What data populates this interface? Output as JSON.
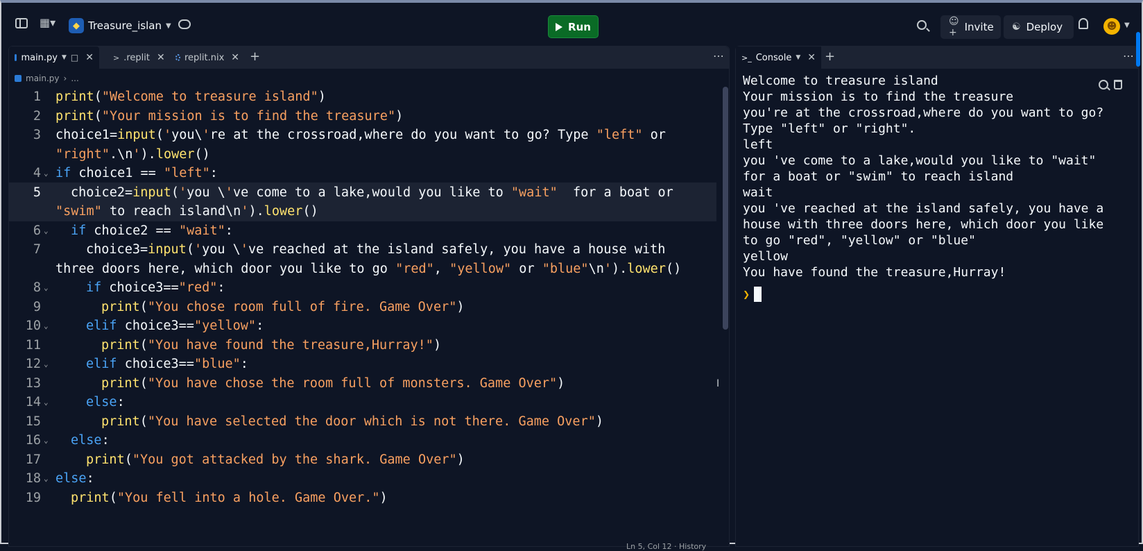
{
  "topbar": {
    "project_name": "Treasure_islan",
    "run_label": "Run",
    "invite_label": "Invite",
    "deploy_label": "Deploy"
  },
  "editor": {
    "tabs": [
      {
        "label": "main.py",
        "active": true
      },
      {
        "label": ".replit",
        "active": false
      },
      {
        "label": "replit.nix",
        "active": false
      }
    ],
    "breadcrumb": [
      "main.py",
      "..."
    ],
    "status": "Ln 5, Col 12 · History"
  },
  "code_lines": [
    {
      "num": "1",
      "fold": false,
      "indent": 0,
      "text": "print(\"Welcome to treasure island\")"
    },
    {
      "num": "2",
      "fold": false,
      "indent": 0,
      "text": "print(\"Your mission is to find the treasure\")"
    },
    {
      "num": "3",
      "fold": false,
      "indent": 0,
      "text": "choice1=input('you\\'re at the crossroad,where do you want to go? Type \"left\" or"
    },
    {
      "num": "",
      "fold": false,
      "indent": 0,
      "text": "\"right\".\\n').lower()"
    },
    {
      "num": "4",
      "fold": true,
      "indent": 0,
      "text": "if choice1 == \"left\":"
    },
    {
      "num": "5",
      "fold": false,
      "indent": 1,
      "text": "choice2=input('you \\'ve come to a lake,would you like to \"wait\"  for a boat or"
    },
    {
      "num": "",
      "fold": false,
      "indent": 0,
      "text": "\"swim\" to reach island\\n').lower()"
    },
    {
      "num": "6",
      "fold": true,
      "indent": 1,
      "text": "if choice2 == \"wait\":"
    },
    {
      "num": "7",
      "fold": false,
      "indent": 2,
      "text": "choice3=input('you \\'ve reached at the island safely, you have a house with"
    },
    {
      "num": "",
      "fold": false,
      "indent": 0,
      "text": "three doors here, which door you like to go \"red\", \"yellow\" or \"blue\"\\n').lower()"
    },
    {
      "num": "8",
      "fold": true,
      "indent": 2,
      "text": "if choice3==\"red\":"
    },
    {
      "num": "9",
      "fold": false,
      "indent": 3,
      "text": "print(\"You chose room full of fire. Game Over\")"
    },
    {
      "num": "10",
      "fold": true,
      "indent": 2,
      "text": "elif choice3==\"yellow\":"
    },
    {
      "num": "11",
      "fold": false,
      "indent": 3,
      "text": "print(\"You have found the treasure,Hurray!\")"
    },
    {
      "num": "12",
      "fold": true,
      "indent": 2,
      "text": "elif choice3==\"blue\":"
    },
    {
      "num": "13",
      "fold": false,
      "indent": 3,
      "text": "print(\"You have chose the room full of monsters. Game Over\")"
    },
    {
      "num": "14",
      "fold": true,
      "indent": 2,
      "text": "else:"
    },
    {
      "num": "15",
      "fold": false,
      "indent": 3,
      "text": "print(\"You have selected the door which is not there. Game Over\")"
    },
    {
      "num": "16",
      "fold": true,
      "indent": 1,
      "text": "else:"
    },
    {
      "num": "17",
      "fold": false,
      "indent": 2,
      "text": "print(\"You got attacked by the shark. Game Over\")"
    },
    {
      "num": "18",
      "fold": true,
      "indent": 0,
      "text": "else:"
    },
    {
      "num": "19",
      "fold": false,
      "indent": 1,
      "text": "print(\"You fell into a hole. Game Over.\")"
    }
  ],
  "console": {
    "tab_label": "Console",
    "output": [
      "Welcome to treasure island",
      "Your mission is to find the treasure",
      "you're at the crossroad,where do you want to go?",
      "Type \"left\" or \"right\".",
      "left",
      "you 've come to a lake,would you like to \"wait\"",
      "for a boat or \"swim\" to reach island",
      "wait",
      "you 've reached at the island safely, you have a",
      "house with three doors here, which door you like",
      "to go \"red\", \"yellow\" or \"blue\"",
      "yellow",
      "You have found the treasure,Hurray!"
    ]
  },
  "colors": {
    "run_green": "#0a6b26",
    "keyword": "#4aa3f5",
    "function": "#ffe36e",
    "string": "#f8a060"
  }
}
